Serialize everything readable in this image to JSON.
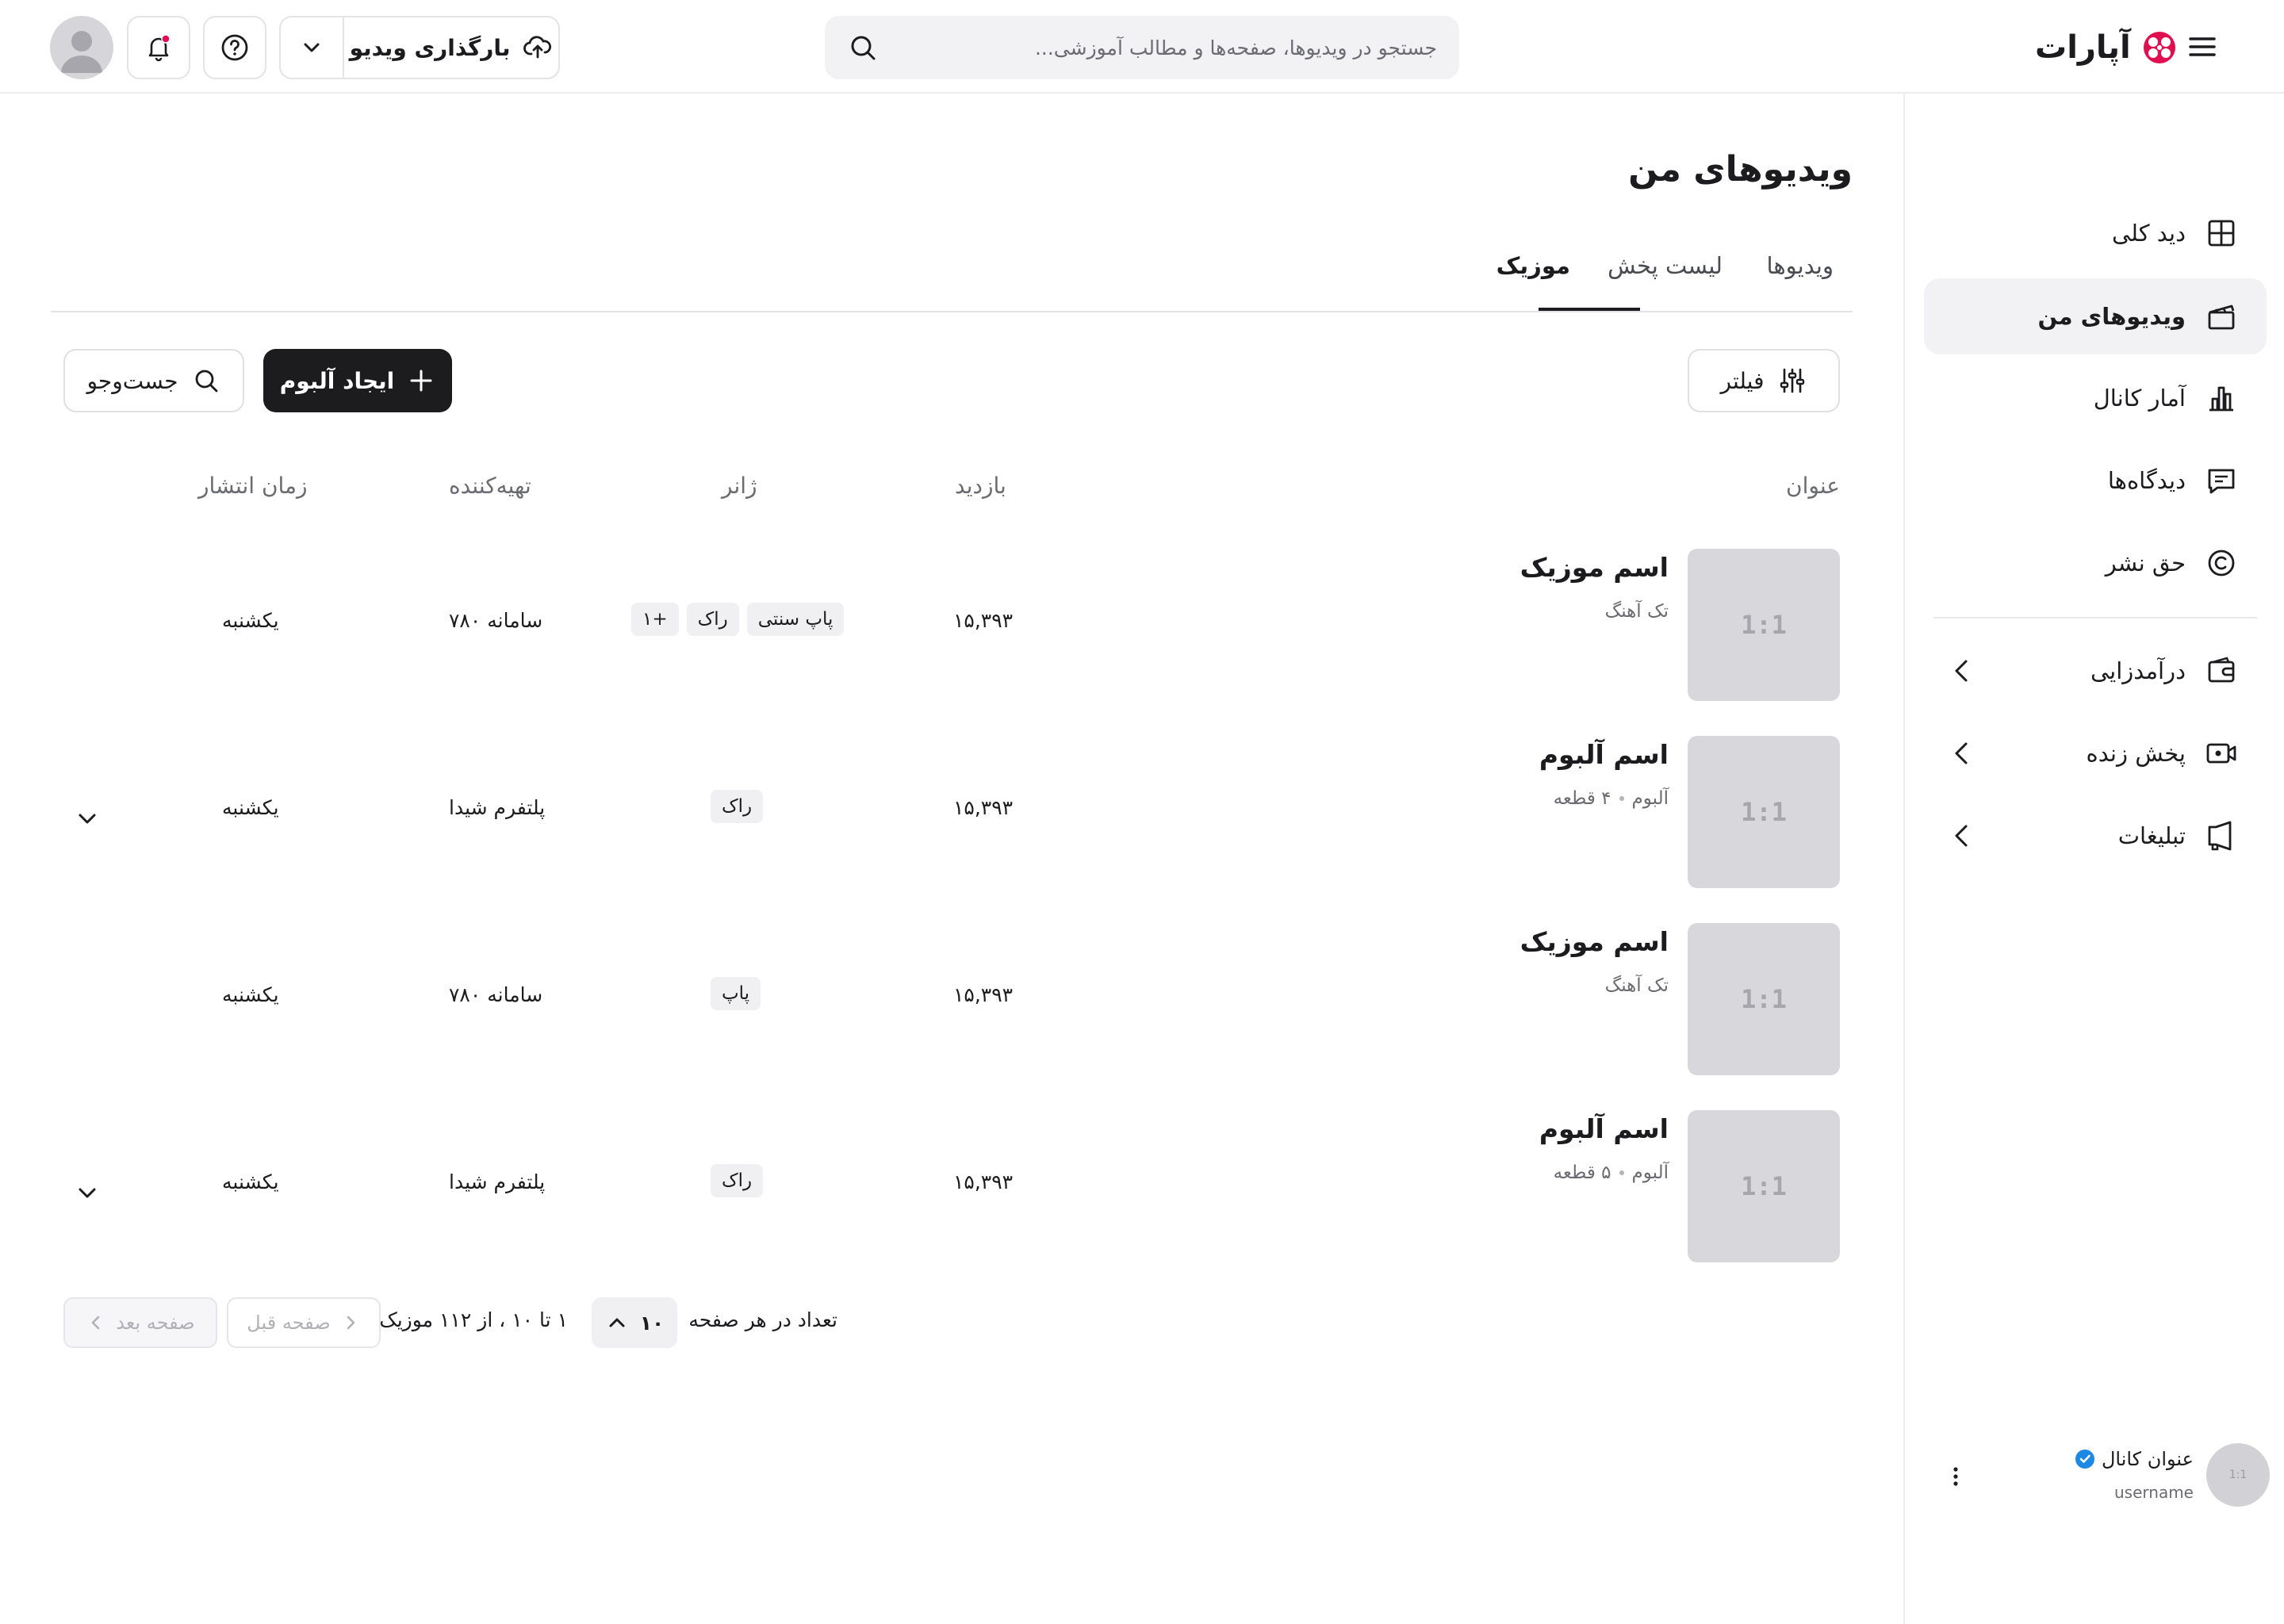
{
  "header": {
    "brand": "آپارات",
    "search_placeholder": "جستجو در ویدیوها، صفحه‌ها و مطالب آموزشی...",
    "upload_label": "بارگذاری ویدیو"
  },
  "sidebar": {
    "items": [
      {
        "label": "دید کلی",
        "icon": "grid-icon"
      },
      {
        "label": "ویدیوهای من",
        "icon": "clapperboard-icon"
      },
      {
        "label": "آمار کانال",
        "icon": "bar-chart-icon"
      },
      {
        "label": "دیدگاه‌ها",
        "icon": "comment-icon"
      },
      {
        "label": "حق نشر",
        "icon": "copyright-icon"
      },
      {
        "label": "درآمدزایی",
        "icon": "wallet-icon"
      },
      {
        "label": "پخش زنده",
        "icon": "live-camera-icon"
      },
      {
        "label": "تبلیغات",
        "icon": "megaphone-icon"
      }
    ],
    "active": "ویدیوهای من",
    "channel": {
      "title": "عنوان کانال",
      "username": "username",
      "avatar_text": "1:1"
    }
  },
  "page": {
    "title": "ویدیوهای من",
    "tabs": [
      "ویدیوها",
      "لیست پخش",
      "موزیک"
    ],
    "active_tab": "موزیک",
    "filter_label": "فیلتر",
    "create_label": "ایجاد آلبوم",
    "search_label": "جست‌وجو"
  },
  "table": {
    "headers": {
      "title": "عنوان",
      "views": "بازدید",
      "genre": "ژانر",
      "producer": "تهیه‌کننده",
      "date": "زمان انتشار"
    },
    "rows": [
      {
        "thumb": "1:1",
        "title": "اسم موزیک",
        "sub": "تک آهنگ",
        "sub2": "",
        "views": "۱۵,۳۹۳",
        "genres": [
          "پاپ سنتی",
          "راک",
          "+۱"
        ],
        "producer": "سامانه ۷۸۰",
        "date": "یکشنبه",
        "expandable": false
      },
      {
        "thumb": "1:1",
        "title": "اسم آلبوم",
        "sub": "آلبوم",
        "sub2": "۴ قطعه",
        "views": "۱۵,۳۹۳",
        "genres": [
          "راک"
        ],
        "producer": "پلتفرم شیدا",
        "date": "یکشنبه",
        "expandable": true
      },
      {
        "thumb": "1:1",
        "title": "اسم موزیک",
        "sub": "تک آهنگ",
        "sub2": "",
        "views": "۱۵,۳۹۳",
        "genres": [
          "پاپ"
        ],
        "producer": "سامانه ۷۸۰",
        "date": "یکشنبه",
        "expandable": false
      },
      {
        "thumb": "1:1",
        "title": "اسم آلبوم",
        "sub": "آلبوم",
        "sub2": "۵ قطعه",
        "views": "۱۵,۳۹۳",
        "genres": [
          "راک"
        ],
        "producer": "پلتفرم شیدا",
        "date": "یکشنبه",
        "expandable": true
      }
    ]
  },
  "pagination": {
    "per_page_label": "تعداد در هر صفحه",
    "per_page_value": "۱۰",
    "range_text": "۱ تا ۱۰ ، از ۱۱۲ موزیک",
    "prev_label": "صفحه قبل",
    "next_label": "صفحه بعد"
  },
  "colors": {
    "accent": "#df0f50",
    "verified": "#1e88e5",
    "dark_button": "#1c1c1f"
  }
}
